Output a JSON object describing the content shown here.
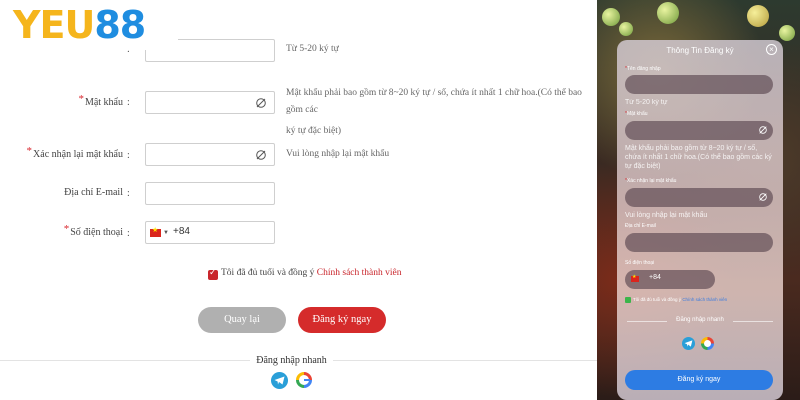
{
  "brand": {
    "part1": "YEU",
    "part2": "88"
  },
  "form": {
    "username_hint": "Từ 5-20 ký tự",
    "password": {
      "label": "Mật khẩu",
      "hint_line1": "Mật khẩu phải bao gồm từ 8~20 ký tự / số, chứa ít nhất 1 chữ hoa.(Có thể bao gồm các",
      "hint_line2": "ký tự đặc biệt)"
    },
    "confirm": {
      "label": "Xác nhận lại mật khẩu",
      "hint": "Vui lòng nhập lại mật khẩu"
    },
    "email": {
      "label": "Địa chỉ E-mail"
    },
    "phone": {
      "label": "Số điện thoại",
      "code": "+84"
    },
    "agree_text": "Tôi đã đủ tuổi và đồng ý",
    "agree_link": "Chính sách thành viên",
    "back_button": "Quay lại",
    "register_button": "Đăng ký ngay",
    "quick_login": "Đăng nhập nhanh",
    "colon": ":",
    "required_mark": "*"
  },
  "mobile": {
    "title": "Thông Tin Đăng ký",
    "close": "×",
    "username_label": "Tên đăng nhập",
    "username_hint": "Từ 5-20 ký tự",
    "password_label": "Mật khẩu",
    "password_hint": "Mật khẩu phải bao gồm từ 8~20 ký tự / số, chứa ít nhất 1 chữ hoa.(Có thể bao gồm các ký tự đặc biệt)",
    "confirm_label": "Xác nhận lại mật khẩu",
    "confirm_hint": "Vui lòng nhập lại mật khẩu",
    "email_label": "Địa chỉ E-mail",
    "phone_label": "Số điện thoại",
    "phone_code": "+84",
    "agree_text": "Tôi đã đủ tuổi và đồng ý",
    "agree_link": "Chính sách thành viên",
    "quick_login": "Đăng nhập nhanh",
    "register_button": "Đăng ký ngay"
  },
  "icons": {
    "eye": "eye-off-icon",
    "flag": "vietnam-flag-icon",
    "telegram": "telegram-icon",
    "google": "google-icon",
    "checkbox": "checkbox-checked-icon"
  },
  "colors": {
    "brand_yellow": "#f5b51c",
    "brand_blue": "#1f8de0",
    "register_red": "#d52b2b",
    "back_gray": "#b0b0b0",
    "mobile_button_blue": "#2d7ce3",
    "link_red": "#c9262c"
  }
}
